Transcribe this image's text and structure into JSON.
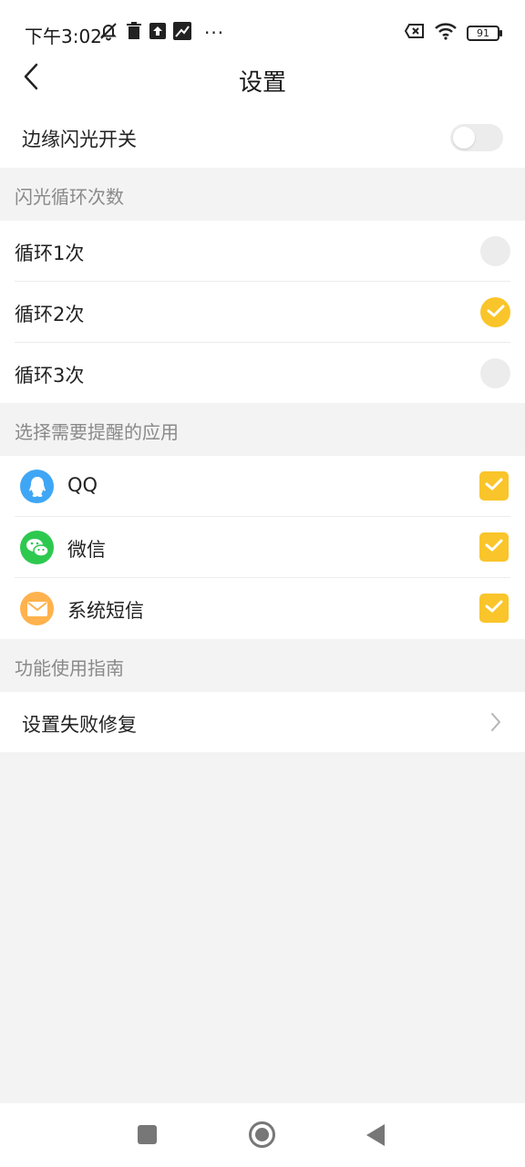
{
  "status_bar": {
    "time": "下午3:02",
    "battery": "91",
    "icons": [
      "muted-bell-icon",
      "trash-icon",
      "upload-icon",
      "photo-icon",
      "more-dots-icon",
      "no-sim-icon",
      "wifi-icon",
      "battery-icon"
    ],
    "more": "···"
  },
  "header": {
    "title": "设置",
    "back_icon": "chevron-left-icon"
  },
  "edge_flash": {
    "label": "边缘闪光开关",
    "enabled": false
  },
  "sections": {
    "loop_header": "闪光循环次数",
    "apps_header": "选择需要提醒的应用",
    "guide_header": "功能使用指南"
  },
  "loop_options": [
    {
      "label": "循环1次",
      "selected": false
    },
    {
      "label": "循环2次",
      "selected": true
    },
    {
      "label": "循环3次",
      "selected": false
    }
  ],
  "apps": [
    {
      "name": "QQ",
      "icon": "qq-icon",
      "color": "#3fa6f5",
      "checked": true
    },
    {
      "name": "微信",
      "icon": "wechat-icon",
      "color": "#2dc94f",
      "checked": true
    },
    {
      "name": "系统短信",
      "icon": "message-icon",
      "color": "#ffb24d",
      "checked": true
    }
  ],
  "guide": {
    "label": "设置失败修复",
    "icon": "chevron-right-icon"
  },
  "colors": {
    "accent": "#f9c52a",
    "background": "#f3f3f3",
    "section_text": "#8a8a8a"
  },
  "nav_bar": {
    "icons": [
      "recent-apps-icon",
      "home-icon",
      "back-icon"
    ]
  }
}
